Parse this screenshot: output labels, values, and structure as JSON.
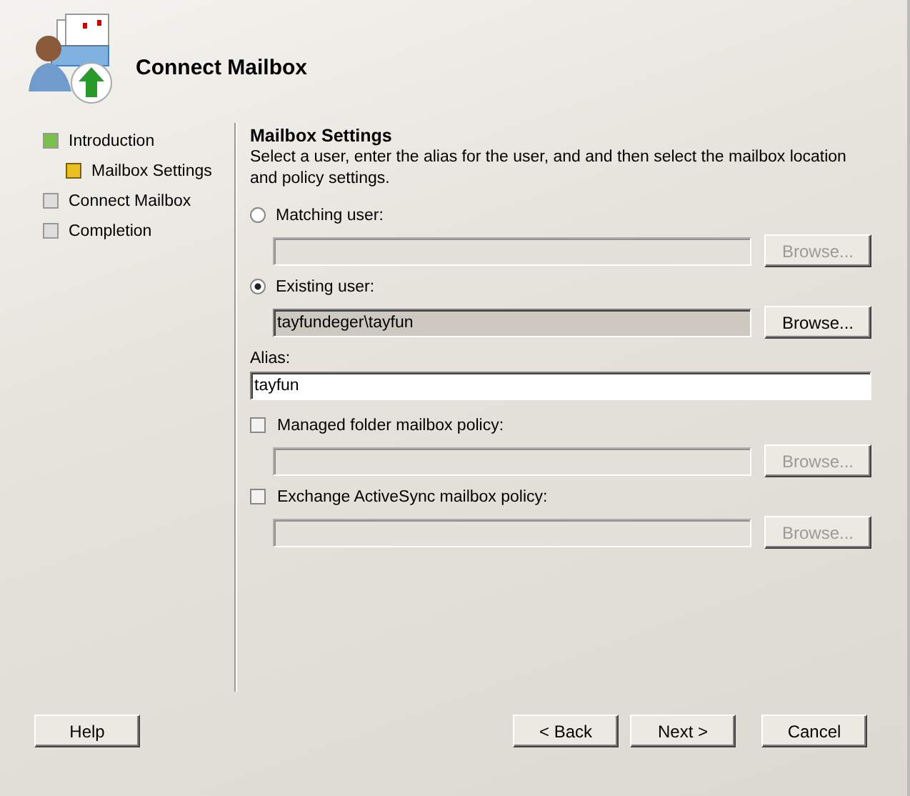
{
  "window": {
    "title": "Connect Mailbox"
  },
  "steps": [
    {
      "label": "Introduction",
      "completed": true,
      "selected": false,
      "children": [
        {
          "label": "Mailbox Settings",
          "completed": false,
          "selected": true
        }
      ]
    },
    {
      "label": "Connect Mailbox",
      "completed": false,
      "selected": false
    },
    {
      "label": "Completion",
      "completed": false,
      "selected": false
    }
  ],
  "section": {
    "title": "Mailbox Settings",
    "description": "Select a user, enter the alias for the user, and and then select the mailbox location and policy settings."
  },
  "options": [
    {
      "kind": "radio",
      "label": "Matching user:",
      "selected": false,
      "disabled": true,
      "button": "Browse..."
    },
    {
      "kind": "radio",
      "label": "Existing user:",
      "selected": true,
      "value": "tayfundeger\\tayfun",
      "disabled": false,
      "button": "Browse..."
    },
    {
      "kind": "text",
      "label": "Alias:",
      "value": "tayfun"
    },
    {
      "kind": "checkbox",
      "label": "Managed folder mailbox policy:",
      "checked": false,
      "disabled": true,
      "button": "Browse..."
    },
    {
      "kind": "checkbox",
      "label": "Exchange ActiveSync mailbox policy:",
      "checked": false,
      "disabled": true,
      "button": "Browse..."
    }
  ],
  "footer": {
    "help": "Help",
    "back": "< Back",
    "next": "Next >",
    "cancel": "Cancel"
  }
}
